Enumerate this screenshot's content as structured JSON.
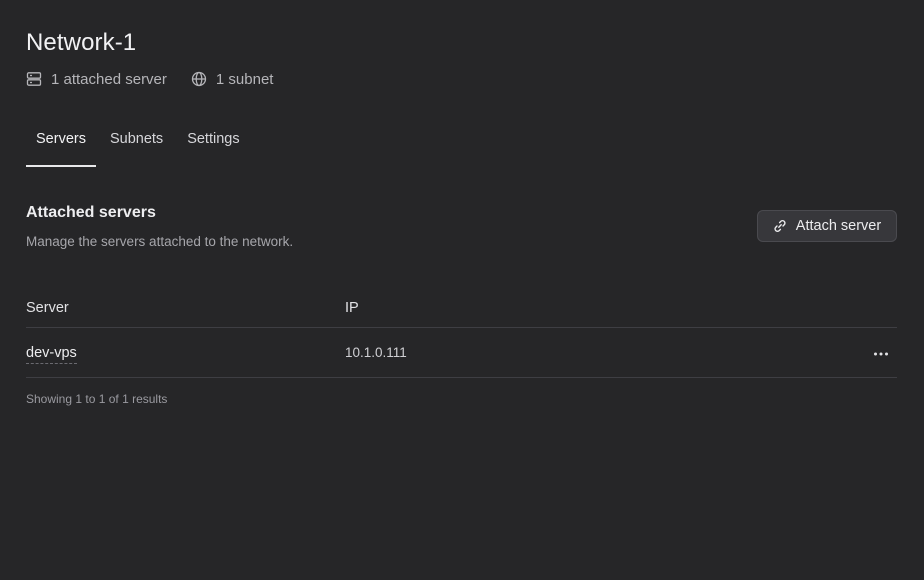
{
  "header": {
    "title": "Network-1",
    "meta": [
      {
        "icon": "server-icon",
        "label": "1 attached server"
      },
      {
        "icon": "globe-icon",
        "label": "1 subnet"
      }
    ]
  },
  "tabs": [
    {
      "label": "Servers",
      "active": true
    },
    {
      "label": "Subnets",
      "active": false
    },
    {
      "label": "Settings",
      "active": false
    }
  ],
  "section": {
    "title": "Attached servers",
    "description": "Manage the servers attached to the network.",
    "action_label": "Attach server",
    "action_icon": "link-icon"
  },
  "table": {
    "columns": [
      "Server",
      "IP"
    ],
    "rows": [
      {
        "server": "dev-vps",
        "ip": "10.1.0.111"
      }
    ],
    "footer": "Showing 1 to 1 of 1 results"
  }
}
